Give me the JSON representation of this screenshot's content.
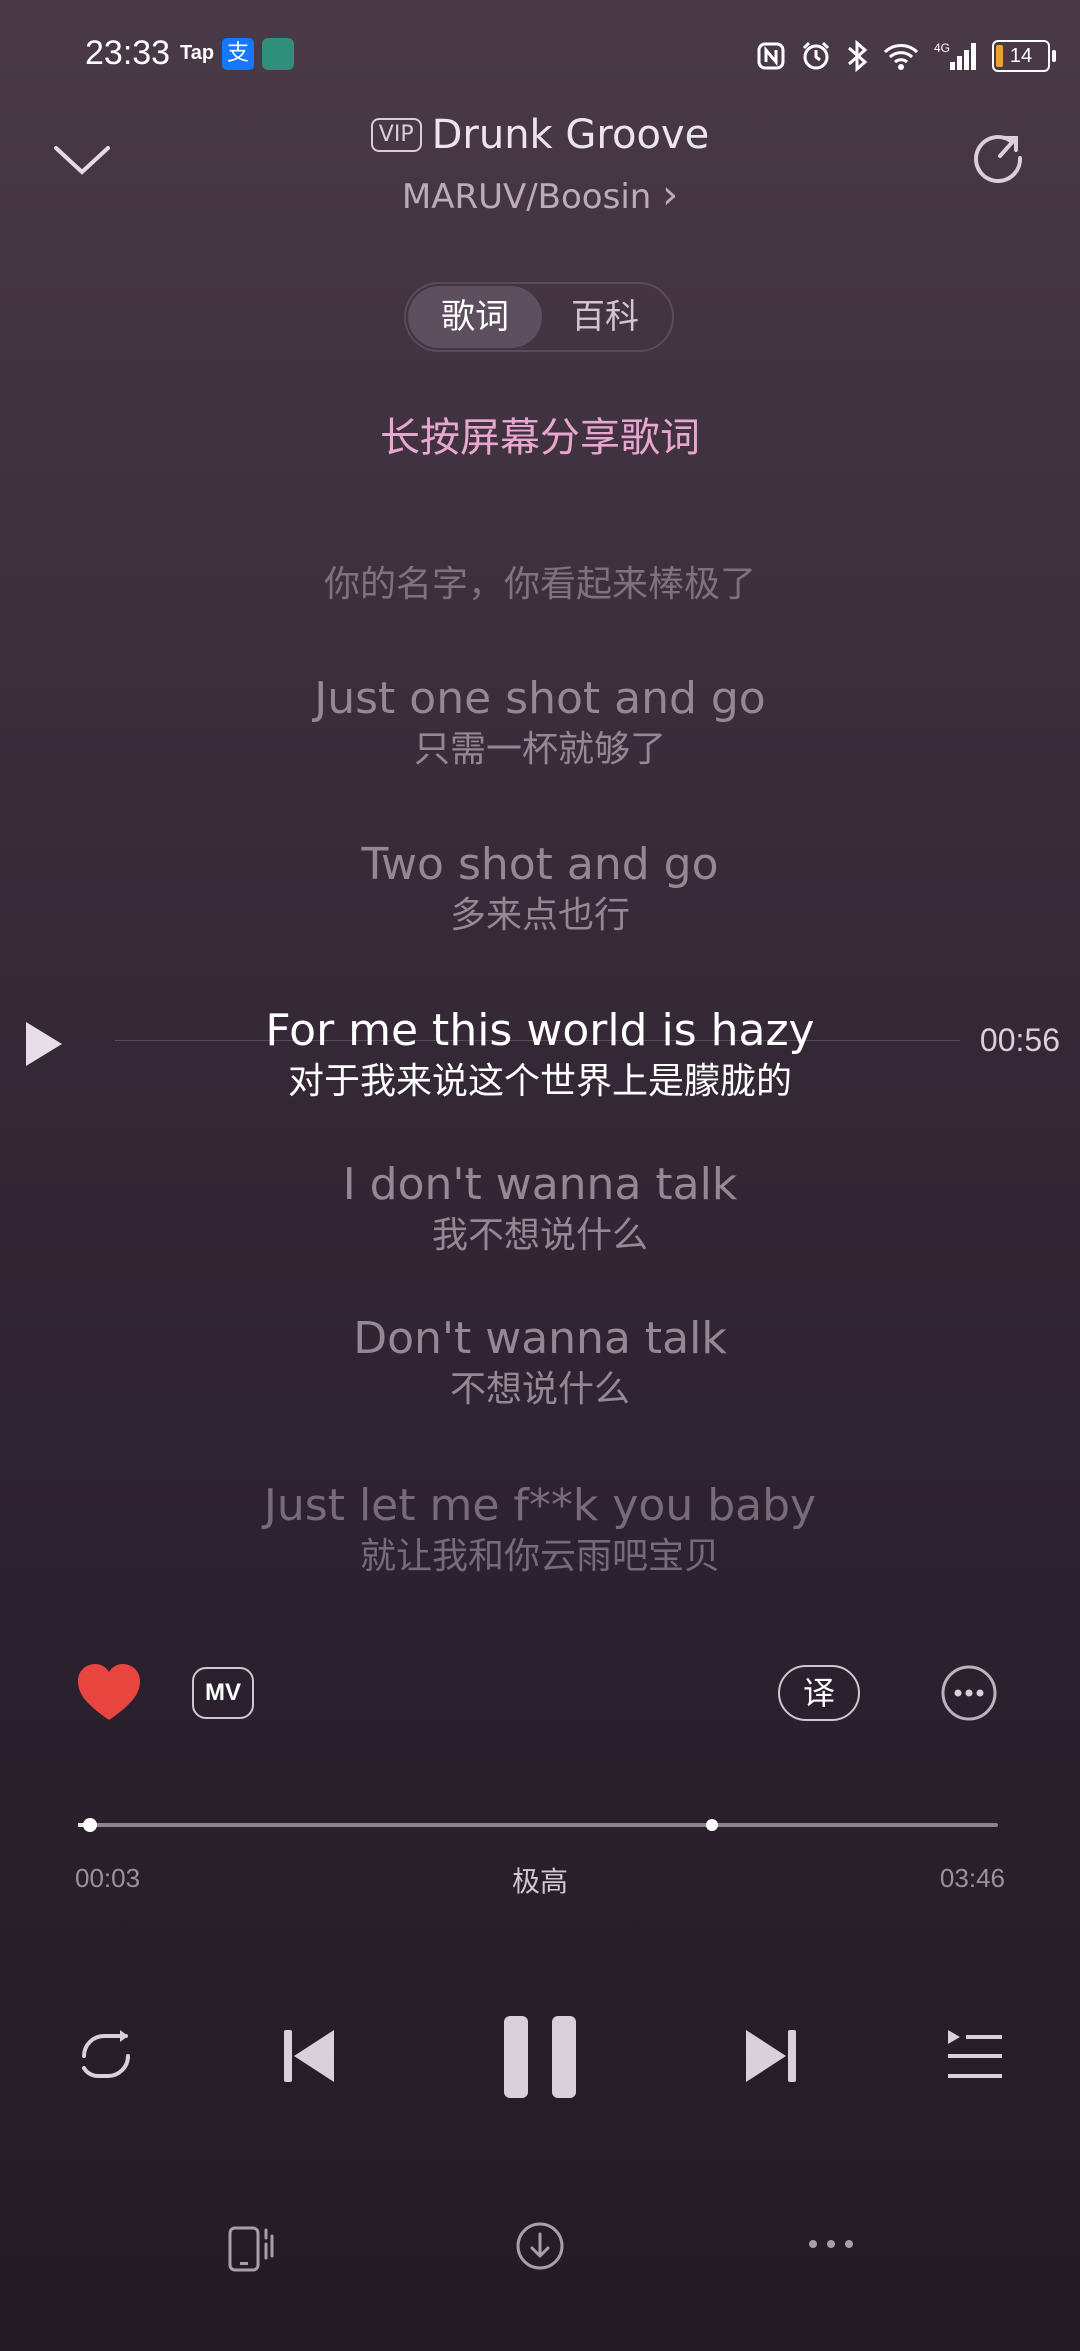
{
  "status_bar": {
    "time": "23:33",
    "tap_label": "Tap",
    "alipay_glyph": "支",
    "battery": "14",
    "icons": [
      "nfc-icon",
      "alarm-icon",
      "bluetooth-icon",
      "wifi-icon",
      "signal-4g-icon",
      "battery-icon"
    ]
  },
  "header": {
    "vip_badge": "VIP",
    "title": "Drunk Groove",
    "artist": "MARUV/Boosin",
    "artist_chevron": "›"
  },
  "tabs": {
    "lyrics": "歌词",
    "wiki": "百科",
    "active": "lyrics"
  },
  "hint": "长按屏幕分享歌词",
  "lyrics": [
    {
      "en": "",
      "zh": "你的名字，你看起来棒极了"
    },
    {
      "en": "Just one shot and go",
      "zh": "只需一杯就够了"
    },
    {
      "en": "Two shot and go",
      "zh": "多来点也行"
    },
    {
      "en": "For me this world is hazy",
      "zh": "对于我来说这个世界上是朦胧的"
    },
    {
      "en": "I don't wanna talk",
      "zh": "我不想说什么"
    },
    {
      "en": "Don't wanna talk",
      "zh": "不想说什么"
    },
    {
      "en": "Just let me f**k you baby",
      "zh": "就让我和你云雨吧宝贝"
    }
  ],
  "current_line_time": "00:56",
  "actions": {
    "mv_label": "MV",
    "translate_label": "译"
  },
  "progress": {
    "elapsed": "00:03",
    "total": "03:46",
    "quality": "极高",
    "fraction": 0.013
  },
  "colors": {
    "accent_hint": "#e8a7cf",
    "heart": "#e8453e"
  }
}
